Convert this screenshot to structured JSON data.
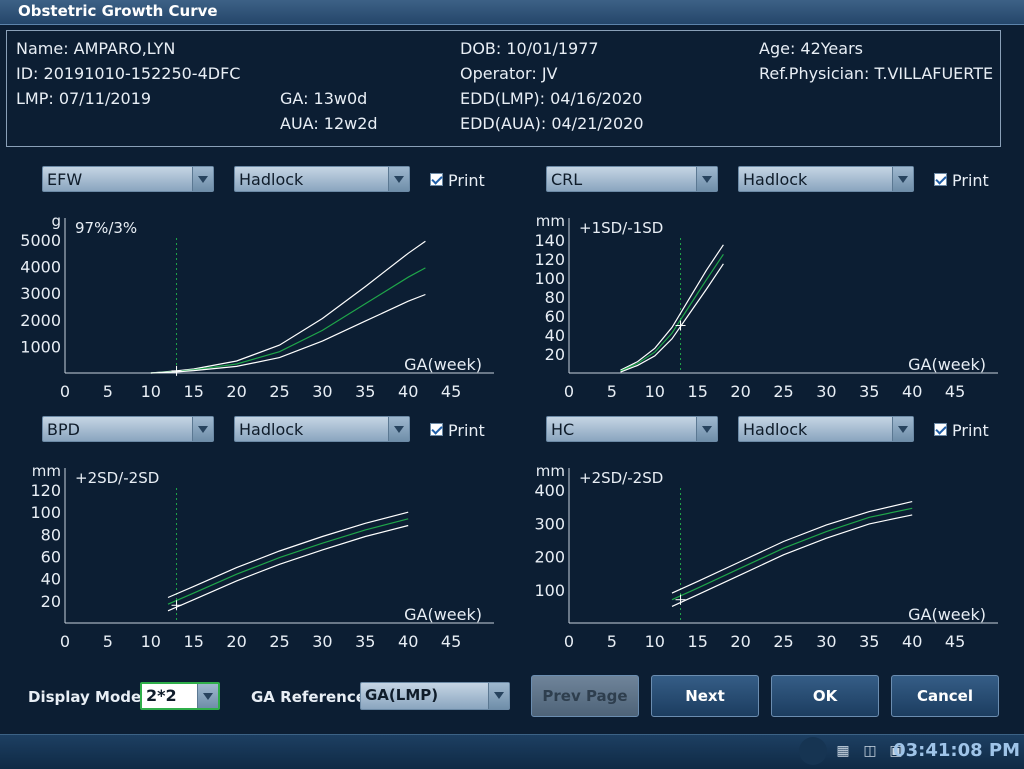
{
  "window": {
    "title": "Obstetric Growth Curve"
  },
  "patient": {
    "name": "Name: AMPARO,LYN",
    "id": "ID: 20191010-152250-4DFC",
    "lmp": "LMP: 07/11/2019",
    "ga": "GA: 13w0d",
    "aua": "AUA: 12w2d",
    "dob": "DOB: 10/01/1977",
    "operator": "Operator: JV",
    "edd_lmp": "EDD(LMP): 04/16/2020",
    "edd_aua": "EDD(AUA): 04/21/2020",
    "age": "Age: 42Years",
    "ref_physician": "Ref.Physician: T.VILLAFUERTE"
  },
  "panels": [
    {
      "measure": "EFW",
      "author": "Hadlock",
      "print_label": "Print",
      "print_checked": true
    },
    {
      "measure": "CRL",
      "author": "Hadlock",
      "print_label": "Print",
      "print_checked": true
    },
    {
      "measure": "BPD",
      "author": "Hadlock",
      "print_label": "Print",
      "print_checked": true
    },
    {
      "measure": "HC",
      "author": "Hadlock",
      "print_label": "Print",
      "print_checked": true
    }
  ],
  "chart_data": [
    {
      "type": "line",
      "unit": "g",
      "legend": "97%/3%",
      "xlabel": "GA(week)",
      "xlim": [
        0,
        50
      ],
      "ylim": [
        0,
        5000
      ],
      "xticks": [
        0,
        5,
        10,
        15,
        20,
        25,
        30,
        35,
        40,
        45
      ],
      "yticks": [
        1000,
        2000,
        3000,
        4000,
        5000
      ],
      "current_ga": 13,
      "marker": {
        "x": 13,
        "y": 80
      },
      "series": [
        {
          "role": "upper",
          "x": [
            10,
            13,
            15,
            20,
            25,
            30,
            35,
            40,
            42
          ],
          "y": [
            0,
            80,
            150,
            450,
            1050,
            2050,
            3250,
            4500,
            4950
          ]
        },
        {
          "role": "mean",
          "x": [
            10,
            13,
            15,
            20,
            25,
            30,
            35,
            40,
            42
          ],
          "y": [
            0,
            60,
            120,
            340,
            800,
            1600,
            2600,
            3600,
            3950
          ]
        },
        {
          "role": "lower",
          "x": [
            10,
            13,
            15,
            20,
            25,
            30,
            35,
            40,
            42
          ],
          "y": [
            0,
            40,
            90,
            250,
            580,
            1200,
            1950,
            2700,
            2950
          ]
        }
      ]
    },
    {
      "type": "line",
      "unit": "mm",
      "legend": "+1SD/-1SD",
      "xlabel": "GA(week)",
      "xlim": [
        0,
        50
      ],
      "ylim": [
        0,
        150
      ],
      "xticks": [
        0,
        5,
        10,
        15,
        20,
        25,
        30,
        35,
        40,
        45
      ],
      "yticks": [
        20,
        40,
        60,
        80,
        100,
        120,
        140
      ],
      "current_ga": 13,
      "marker": {
        "x": 13,
        "y": 50
      },
      "series": [
        {
          "role": "upper",
          "x": [
            6,
            8,
            10,
            12,
            14,
            16,
            18
          ],
          "y": [
            3,
            12,
            26,
            48,
            78,
            108,
            135
          ]
        },
        {
          "role": "mean",
          "x": [
            6,
            8,
            10,
            12,
            14,
            16,
            18
          ],
          "y": [
            2,
            10,
            22,
            42,
            70,
            98,
            125
          ]
        },
        {
          "role": "lower",
          "x": [
            6,
            8,
            10,
            12,
            14,
            16,
            18
          ],
          "y": [
            1,
            8,
            18,
            36,
            62,
            88,
            115
          ]
        }
      ]
    },
    {
      "type": "line",
      "unit": "mm",
      "legend": "+2SD/-2SD",
      "xlabel": "GA(week)",
      "xlim": [
        0,
        50
      ],
      "ylim": [
        0,
        130
      ],
      "xticks": [
        0,
        5,
        10,
        15,
        20,
        25,
        30,
        35,
        40,
        45
      ],
      "yticks": [
        20,
        40,
        60,
        80,
        100,
        120
      ],
      "current_ga": 13,
      "marker": {
        "x": 13,
        "y": 16
      },
      "series": [
        {
          "role": "upper",
          "x": [
            12,
            15,
            20,
            25,
            30,
            35,
            40
          ],
          "y": [
            23,
            33,
            50,
            65,
            78,
            90,
            100
          ]
        },
        {
          "role": "mean",
          "x": [
            12,
            15,
            20,
            25,
            30,
            35,
            40
          ],
          "y": [
            17,
            27,
            44,
            59,
            72,
            84,
            94
          ]
        },
        {
          "role": "lower",
          "x": [
            12,
            15,
            20,
            25,
            30,
            35,
            40
          ],
          "y": [
            11,
            21,
            38,
            53,
            66,
            78,
            88
          ]
        }
      ]
    },
    {
      "type": "line",
      "unit": "mm",
      "legend": "+2SD/-2SD",
      "xlabel": "GA(week)",
      "xlim": [
        0,
        50
      ],
      "ylim": [
        0,
        420
      ],
      "xticks": [
        0,
        5,
        10,
        15,
        20,
        25,
        30,
        35,
        40,
        45
      ],
      "yticks": [
        100,
        200,
        300,
        400
      ],
      "current_ga": 13,
      "marker": {
        "x": 13,
        "y": 70
      },
      "series": [
        {
          "role": "upper",
          "x": [
            12,
            15,
            20,
            25,
            30,
            35,
            40
          ],
          "y": [
            90,
            125,
            185,
            245,
            295,
            335,
            365
          ]
        },
        {
          "role": "mean",
          "x": [
            12,
            15,
            20,
            25,
            30,
            35,
            40
          ],
          "y": [
            70,
            105,
            165,
            225,
            275,
            318,
            345
          ]
        },
        {
          "role": "lower",
          "x": [
            12,
            15,
            20,
            25,
            30,
            35,
            40
          ],
          "y": [
            50,
            85,
            145,
            205,
            255,
            298,
            325
          ]
        }
      ]
    }
  ],
  "footer": {
    "display_mode_label": "Display Mode:",
    "display_mode_value": "2*2",
    "ga_reference_label": "GA Reference:",
    "ga_reference_value": "GA(LMP)",
    "prev_page": "Prev Page",
    "next": "Next",
    "ok": "OK",
    "cancel": "Cancel"
  },
  "taskbar": {
    "clock": "03:41:08 PM"
  },
  "colors": {
    "background": "#0c1e33",
    "mean_curve": "#1fa64a",
    "band_curve": "#ffffff",
    "ga_line": "#1fa64a"
  }
}
